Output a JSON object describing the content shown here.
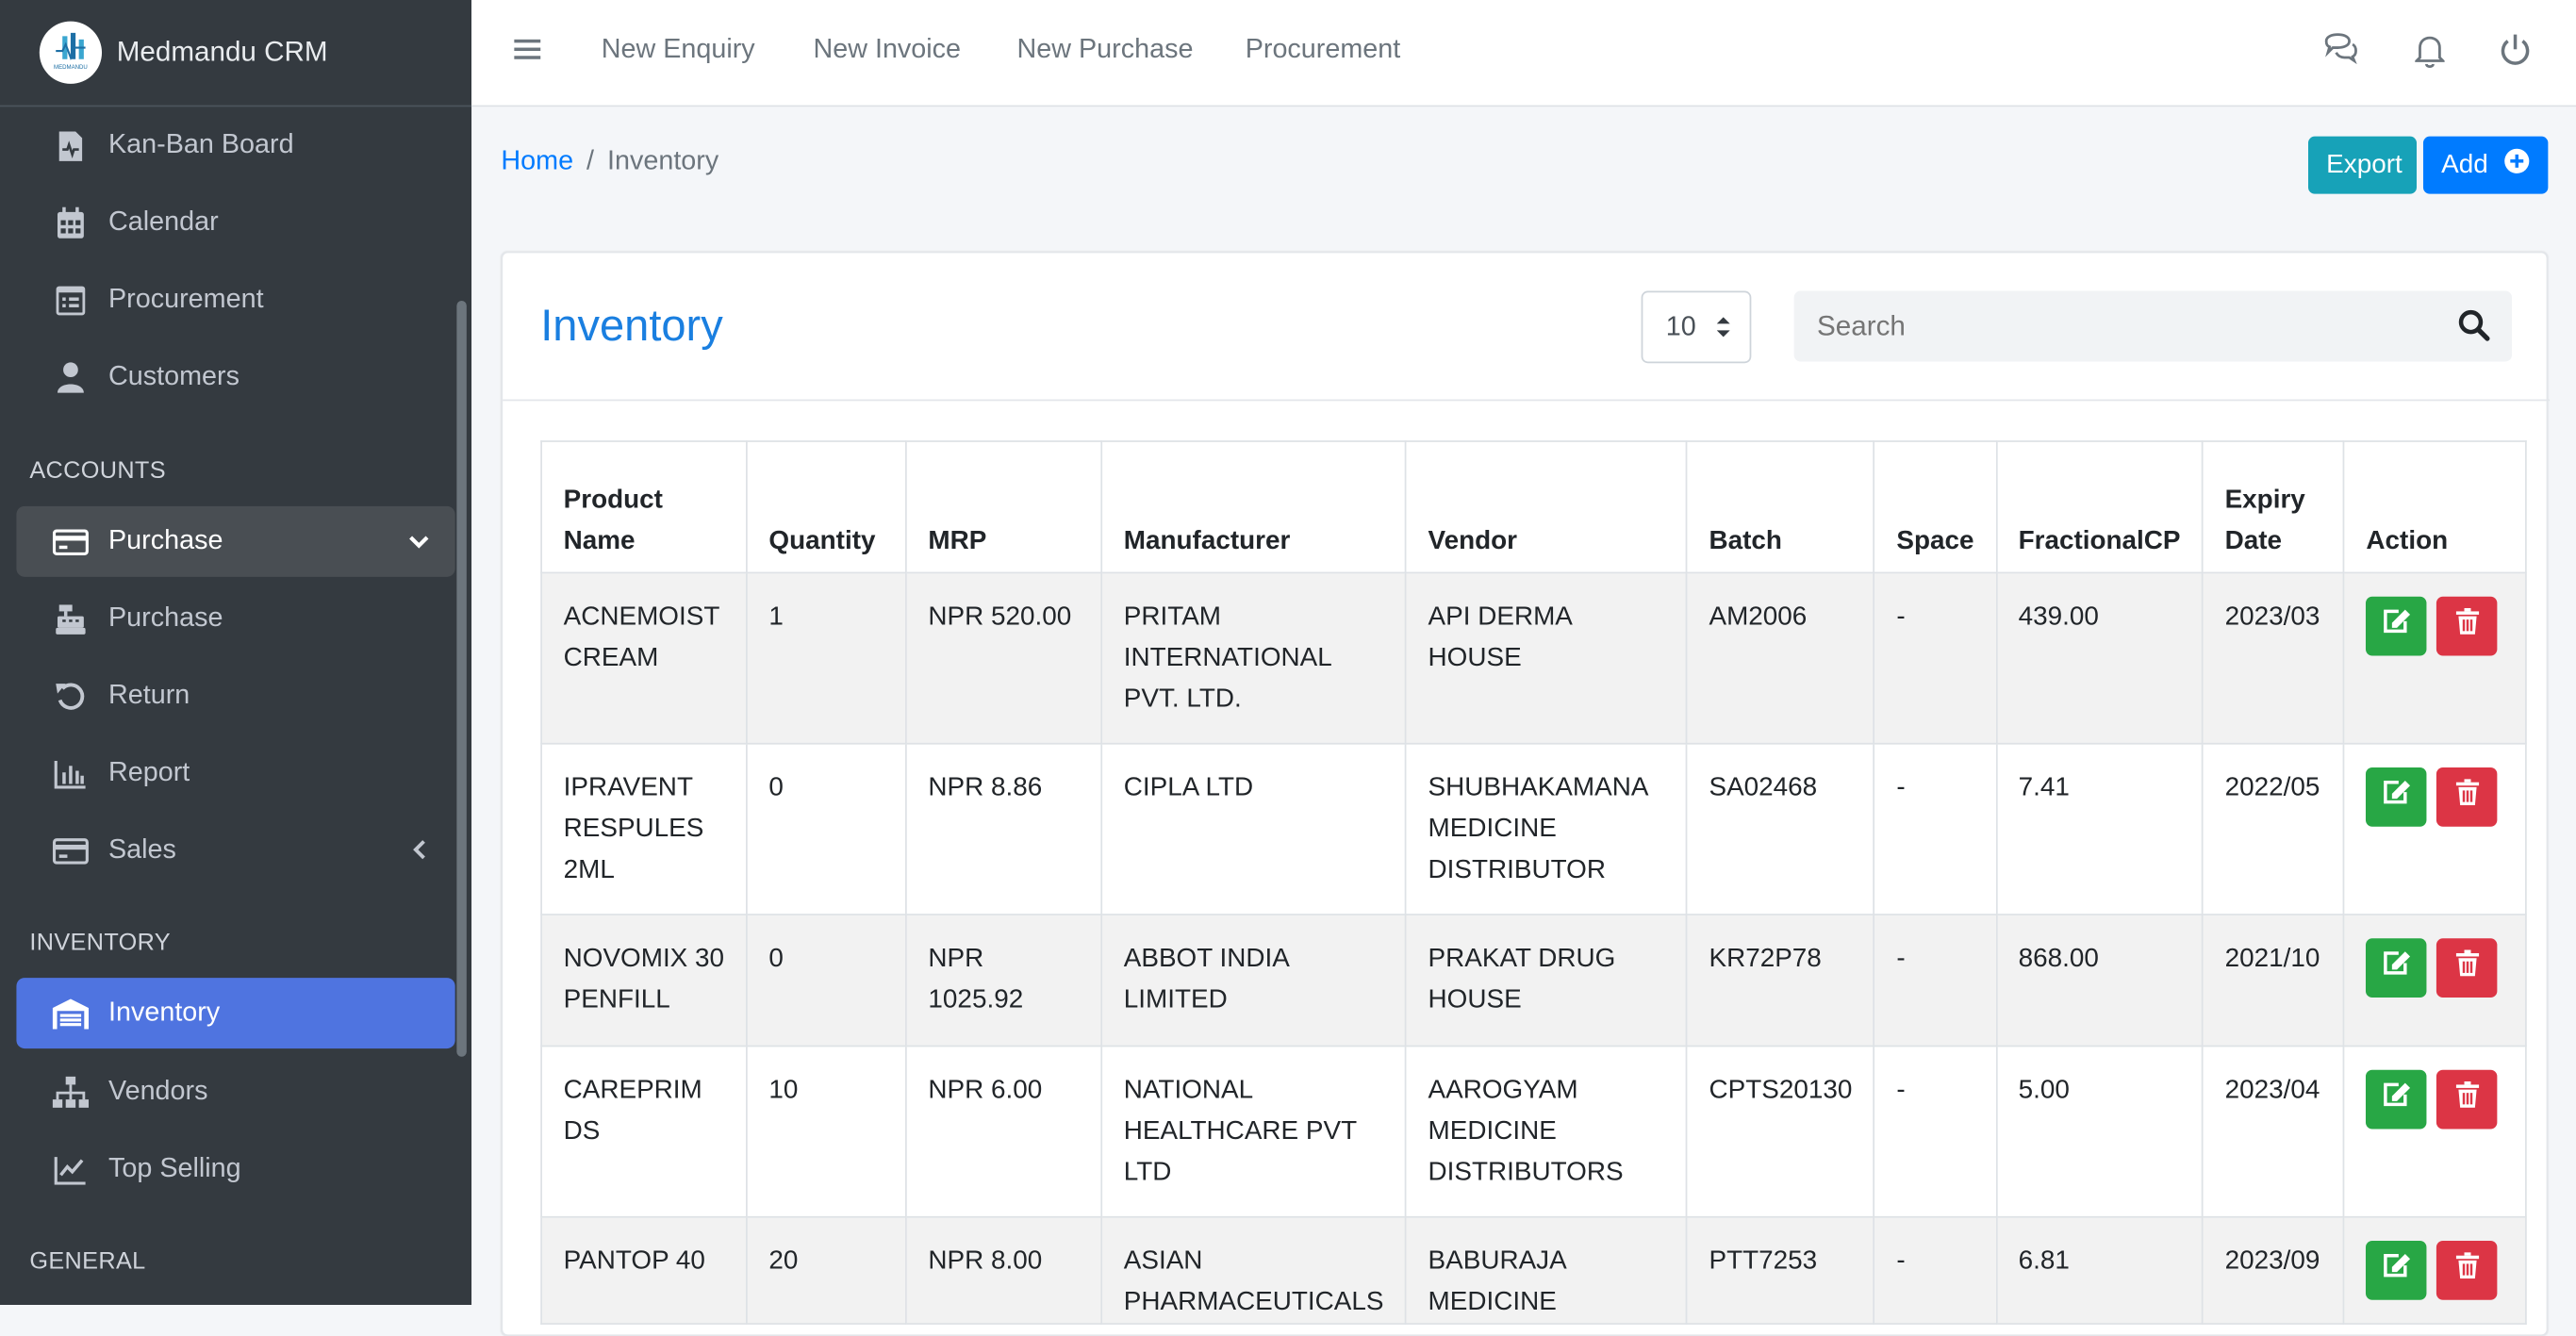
{
  "brand": {
    "name": "Medmandu CRM",
    "logo_text": "MEDMANDU"
  },
  "sidebar": {
    "items": [
      {
        "label": "Kan-Ban Board",
        "icon": "kanban-icon"
      },
      {
        "label": "Calendar",
        "icon": "calendar-icon"
      },
      {
        "label": "Procurement",
        "icon": "procurement-icon"
      },
      {
        "label": "Customers",
        "icon": "user-icon"
      }
    ],
    "accounts_header": "ACCOUNTS",
    "accounts": [
      {
        "label": "Purchase",
        "icon": "credit-card-icon",
        "state": "open"
      },
      {
        "label": "Purchase",
        "icon": "cash-register-icon"
      },
      {
        "label": "Return",
        "icon": "undo-icon"
      },
      {
        "label": "Report",
        "icon": "bar-chart-icon"
      },
      {
        "label": "Sales",
        "icon": "credit-card-icon"
      }
    ],
    "inventory_header": "INVENTORY",
    "inventory": [
      {
        "label": "Inventory",
        "icon": "warehouse-icon",
        "state": "active"
      },
      {
        "label": "Vendors",
        "icon": "sitemap-icon"
      },
      {
        "label": "Top Selling",
        "icon": "line-chart-icon"
      }
    ],
    "general_header": "GENERAL"
  },
  "topbar": {
    "links": [
      "New Enquiry",
      "New Invoice",
      "New Purchase",
      "Procurement"
    ]
  },
  "breadcrumb": {
    "home": "Home",
    "separator": "/",
    "current": "Inventory"
  },
  "actions": {
    "export": "Export",
    "add": "Add"
  },
  "card": {
    "title": "Inventory",
    "page_size": "10",
    "search_placeholder": "Search"
  },
  "table": {
    "headers": [
      "Product Name",
      "Quantity",
      "MRP",
      "Manufacturer",
      "Vendor",
      "Batch",
      "Space",
      "FractionalCP",
      "Expiry Date",
      "Action"
    ],
    "rows": [
      [
        "ACNEMOIST CREAM",
        "1",
        "NPR 520.00",
        "PRITAM INTERNATIONAL PVT. LTD.",
        "API DERMA HOUSE",
        "AM2006",
        "-",
        "439.00",
        "2023/03"
      ],
      [
        "IPRAVENT RESPULES 2ML",
        "0",
        "NPR 8.86",
        "CIPLA LTD",
        "SHUBHAKAMANA MEDICINE DISTRIBUTOR",
        "SA02468",
        "-",
        "7.41",
        "2022/05"
      ],
      [
        "NOVOMIX 30 PENFILL",
        "0",
        "NPR 1025.92",
        "ABBOT INDIA LIMITED",
        "PRAKAT DRUG HOUSE",
        "KR72P78",
        "-",
        "868.00",
        "2021/10"
      ],
      [
        "CAREPRIM DS",
        "10",
        "NPR 6.00",
        "NATIONAL HEALTHCARE PVT LTD",
        "AAROGYAM MEDICINE DISTRIBUTORS",
        "CPTS20130",
        "-",
        "5.00",
        "2023/04"
      ],
      [
        "PANTOP 40",
        "20",
        "NPR 8.00",
        "ASIAN PHARMACEUTICALS",
        "BABURAJA MEDICINE",
        "PTT7253",
        "-",
        "6.81",
        "2023/09"
      ]
    ]
  },
  "colors": {
    "sidebar_bg": "#343a40",
    "active": "#4f74e0",
    "primary": "#007bff",
    "info": "#17a2b8",
    "success": "#28a745",
    "danger": "#dc3545"
  }
}
